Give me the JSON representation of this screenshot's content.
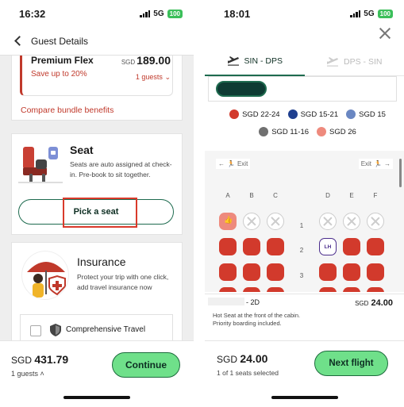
{
  "left": {
    "status": {
      "time": "16:32",
      "network": "5G",
      "battery": "100"
    },
    "header": {
      "title": "Guest Details"
    },
    "bundle": {
      "name": "Premium Flex",
      "savings": "Save up to 20%",
      "currency": "SGD",
      "price": "189.00",
      "guests": "1 guests",
      "compare_link": "Compare bundle benefits"
    },
    "seat": {
      "title": "Seat",
      "description": "Seats are auto assigned at check-in. Pre-book to sit together.",
      "button_label": "Pick a seat"
    },
    "insurance": {
      "title": "Insurance",
      "description": "Protect your trip with one click, add travel insurance now",
      "option_name": "Comprehensive Travel"
    },
    "footer": {
      "currency": "SGD",
      "total": "431.79",
      "guests": "1 guests",
      "continue_label": "Continue"
    }
  },
  "right": {
    "status": {
      "time": "18:01",
      "network": "5G",
      "battery": "100"
    },
    "tabs": [
      {
        "label": "SIN - DPS"
      },
      {
        "label": "DPS - SIN"
      }
    ],
    "legend": [
      {
        "label": "SGD 22-24",
        "color": "#d23a2c"
      },
      {
        "label": "SGD 15-21",
        "color": "#1f3f8f"
      },
      {
        "label": "SGD 15",
        "color": "#6a87c2"
      },
      {
        "label": "SGD 11-16",
        "color": "#707070"
      },
      {
        "label": "SGD 26",
        "color": "#ee8a7d"
      }
    ],
    "seatmap": {
      "exit_label": "Exit",
      "columns": [
        "A",
        "B",
        "C",
        "D",
        "E",
        "F"
      ],
      "rows": [
        "1",
        "2",
        "3"
      ],
      "lh_label": "LH"
    },
    "selected_seat": {
      "code": "- 2D",
      "currency": "SGD",
      "price": "24.00",
      "note": "Hot Seat at the front of the cabin. Priority boarding included."
    },
    "footer": {
      "currency": "SGD",
      "total": "24.00",
      "selected_count": "1 of 1 seats selected",
      "next_label": "Next flight"
    }
  }
}
